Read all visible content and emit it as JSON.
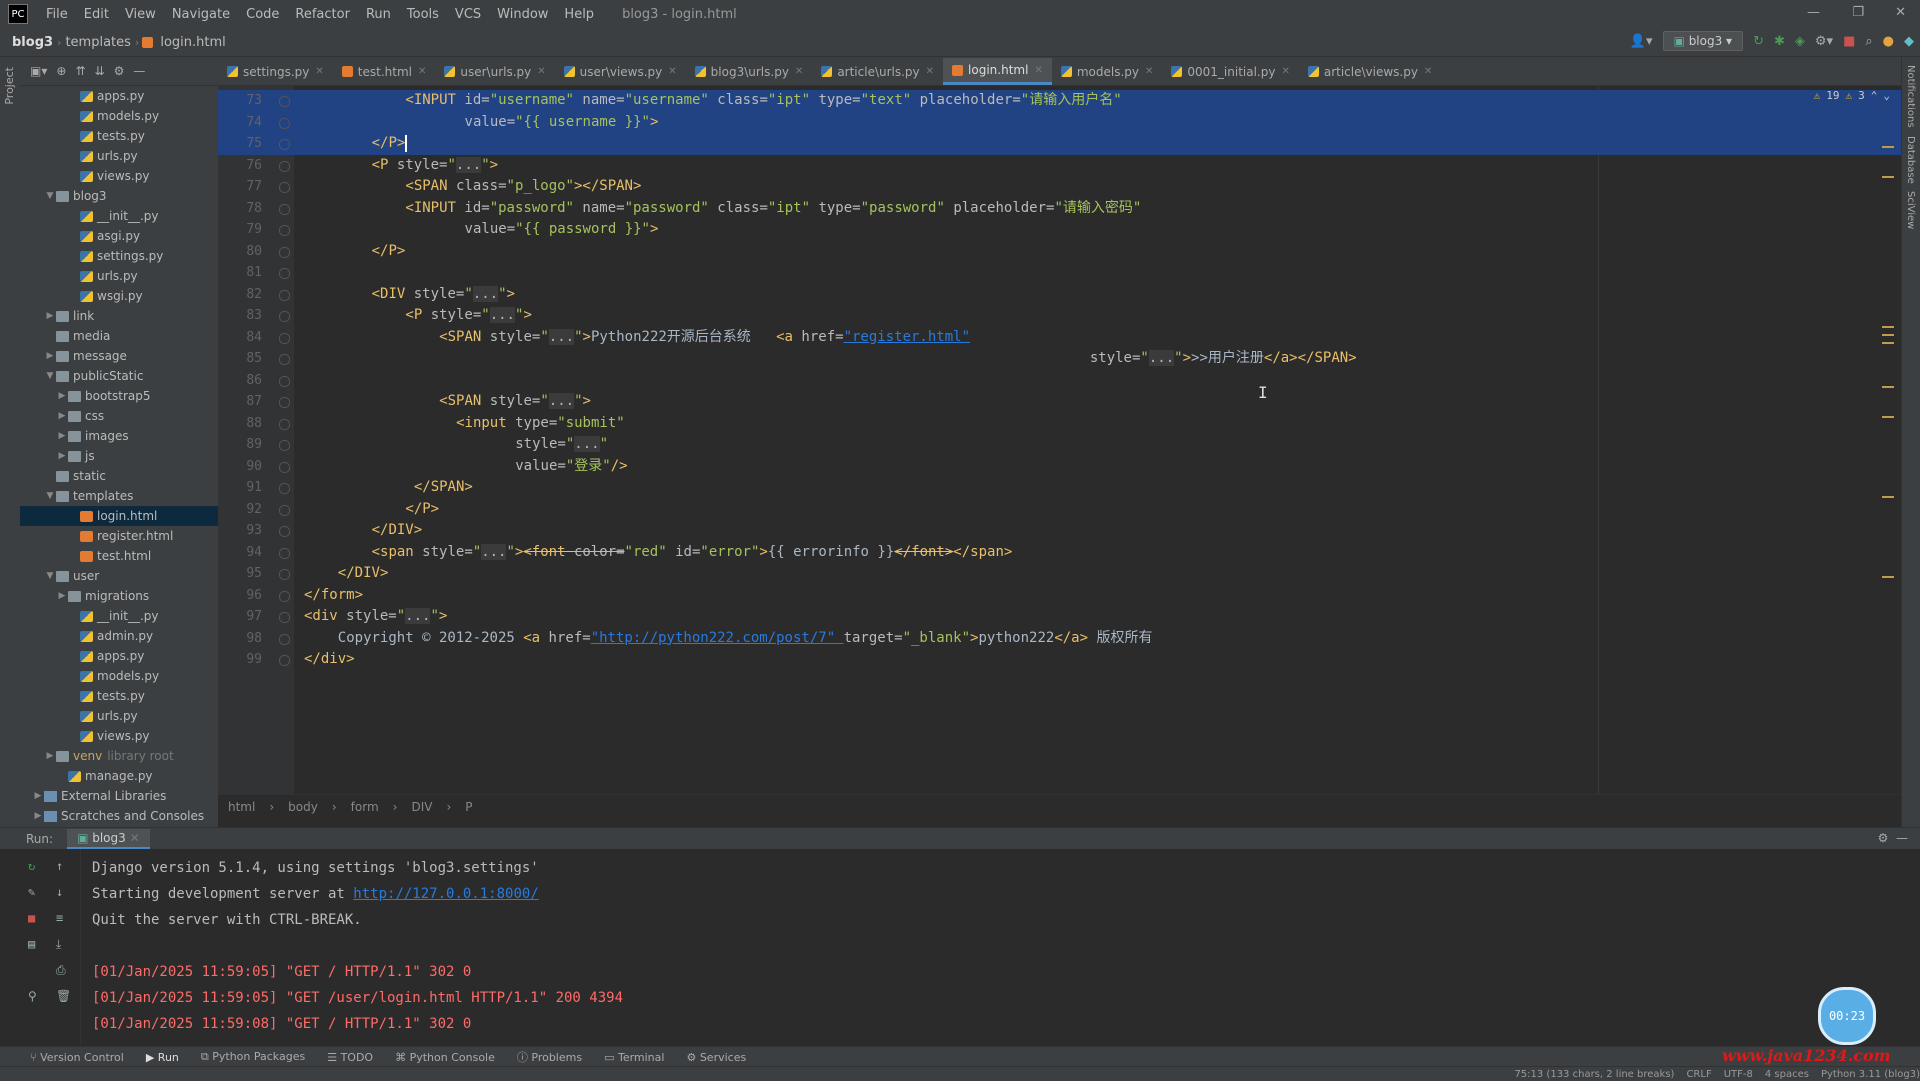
{
  "app": {
    "menu": [
      "File",
      "Edit",
      "View",
      "Navigate",
      "Code",
      "Refactor",
      "Run",
      "Tools",
      "VCS",
      "Window",
      "Help"
    ],
    "window_title": "blog3 - login.html",
    "breadcrumb": [
      "blog3",
      "templates",
      "login.html"
    ],
    "run_config": "blog3"
  },
  "project_tree": [
    {
      "label": "apps.py",
      "indent": 4,
      "type": "py"
    },
    {
      "label": "models.py",
      "indent": 4,
      "type": "py"
    },
    {
      "label": "tests.py",
      "indent": 4,
      "type": "py"
    },
    {
      "label": "urls.py",
      "indent": 4,
      "type": "py"
    },
    {
      "label": "views.py",
      "indent": 4,
      "type": "py"
    },
    {
      "label": "blog3",
      "indent": 2,
      "type": "folder",
      "open": true
    },
    {
      "label": "__init__.py",
      "indent": 4,
      "type": "py"
    },
    {
      "label": "asgi.py",
      "indent": 4,
      "type": "py"
    },
    {
      "label": "settings.py",
      "indent": 4,
      "type": "py"
    },
    {
      "label": "urls.py",
      "indent": 4,
      "type": "py"
    },
    {
      "label": "wsgi.py",
      "indent": 4,
      "type": "py"
    },
    {
      "label": "link",
      "indent": 2,
      "type": "folder",
      "open": false
    },
    {
      "label": "media",
      "indent": 2,
      "type": "folder",
      "leaf": true
    },
    {
      "label": "message",
      "indent": 2,
      "type": "folder",
      "open": false
    },
    {
      "label": "publicStatic",
      "indent": 2,
      "type": "folder",
      "open": true
    },
    {
      "label": "bootstrap5",
      "indent": 3,
      "type": "folder",
      "open": false
    },
    {
      "label": "css",
      "indent": 3,
      "type": "folder",
      "open": false
    },
    {
      "label": "images",
      "indent": 3,
      "type": "folder",
      "open": false
    },
    {
      "label": "js",
      "indent": 3,
      "type": "folder",
      "open": false
    },
    {
      "label": "static",
      "indent": 2,
      "type": "folder",
      "leaf": true
    },
    {
      "label": "templates",
      "indent": 2,
      "type": "folder",
      "open": true
    },
    {
      "label": "login.html",
      "indent": 4,
      "type": "html",
      "selected": true
    },
    {
      "label": "register.html",
      "indent": 4,
      "type": "html"
    },
    {
      "label": "test.html",
      "indent": 4,
      "type": "html"
    },
    {
      "label": "user",
      "indent": 2,
      "type": "folder",
      "open": true
    },
    {
      "label": "migrations",
      "indent": 3,
      "type": "folder",
      "open": false
    },
    {
      "label": "__init__.py",
      "indent": 4,
      "type": "py"
    },
    {
      "label": "admin.py",
      "indent": 4,
      "type": "py"
    },
    {
      "label": "apps.py",
      "indent": 4,
      "type": "py"
    },
    {
      "label": "models.py",
      "indent": 4,
      "type": "py"
    },
    {
      "label": "tests.py",
      "indent": 4,
      "type": "py"
    },
    {
      "label": "urls.py",
      "indent": 4,
      "type": "py"
    },
    {
      "label": "views.py",
      "indent": 4,
      "type": "py"
    },
    {
      "label": "venv",
      "indent": 2,
      "type": "folder",
      "open": false,
      "note": "library root"
    },
    {
      "label": "manage.py",
      "indent": 3,
      "type": "py"
    },
    {
      "label": "External Libraries",
      "indent": 1,
      "type": "lib",
      "open": false
    },
    {
      "label": "Scratches and Consoles",
      "indent": 1,
      "type": "lib",
      "open": false
    }
  ],
  "tabs": [
    {
      "label": "settings.py",
      "type": "py"
    },
    {
      "label": "test.html",
      "type": "html"
    },
    {
      "label": "user\\urls.py",
      "type": "py"
    },
    {
      "label": "user\\views.py",
      "type": "py"
    },
    {
      "label": "blog3\\urls.py",
      "type": "py"
    },
    {
      "label": "article\\urls.py",
      "type": "py"
    },
    {
      "label": "login.html",
      "type": "html",
      "active": true
    },
    {
      "label": "models.py",
      "type": "py"
    },
    {
      "label": "0001_initial.py",
      "type": "py"
    },
    {
      "label": "article\\views.py",
      "type": "py"
    }
  ],
  "inspections": {
    "warnings": "19",
    "weak": "3"
  },
  "code_lines": [
    {
      "n": "73",
      "indent": 12,
      "sel": true,
      "tokens": [
        [
          "tag",
          "<INPUT "
        ],
        [
          "attr",
          "id="
        ],
        [
          "str",
          "\"username\" "
        ],
        [
          "attr",
          "name="
        ],
        [
          "str",
          "\"username\" "
        ],
        [
          "attr",
          "class="
        ],
        [
          "str",
          "\"ipt\" "
        ],
        [
          "attr",
          "type="
        ],
        [
          "str",
          "\"text\" "
        ],
        [
          "attr",
          "placeholder="
        ],
        [
          "str",
          "\"请输入用户名\""
        ]
      ]
    },
    {
      "n": "74",
      "indent": 19,
      "sel": true,
      "tokens": [
        [
          "attr",
          "value="
        ],
        [
          "str",
          "\"{{ username }}\""
        ],
        [
          "tag",
          ">"
        ]
      ]
    },
    {
      "n": "75",
      "indent": 8,
      "sel": true,
      "caret": true,
      "tokens": [
        [
          "tag",
          "</P>"
        ]
      ]
    },
    {
      "n": "76",
      "indent": 8,
      "tokens": [
        [
          "tag",
          "<P "
        ],
        [
          "attr",
          "style="
        ],
        [
          "str",
          "\""
        ],
        [
          "fold",
          "..."
        ],
        [
          "str",
          "\""
        ],
        [
          "tag",
          ">"
        ]
      ]
    },
    {
      "n": "77",
      "indent": 12,
      "tokens": [
        [
          "tag",
          "<SPAN "
        ],
        [
          "attr",
          "class="
        ],
        [
          "str",
          "\"p_logo\""
        ],
        [
          "tag",
          "></SPAN>"
        ]
      ]
    },
    {
      "n": "78",
      "indent": 12,
      "tokens": [
        [
          "tag",
          "<INPUT "
        ],
        [
          "attr",
          "id="
        ],
        [
          "str",
          "\"password\" "
        ],
        [
          "attr",
          "name="
        ],
        [
          "str",
          "\"password\" "
        ],
        [
          "attr",
          "class="
        ],
        [
          "str",
          "\"ipt\" "
        ],
        [
          "attr",
          "type="
        ],
        [
          "str",
          "\"password\" "
        ],
        [
          "attr",
          "placeholder="
        ],
        [
          "str",
          "\"请输入密码\""
        ]
      ]
    },
    {
      "n": "79",
      "indent": 19,
      "tokens": [
        [
          "attr",
          "value="
        ],
        [
          "str",
          "\"{{ password }}\""
        ],
        [
          "tag",
          ">"
        ]
      ]
    },
    {
      "n": "80",
      "indent": 8,
      "tokens": [
        [
          "tag",
          "</P>"
        ]
      ]
    },
    {
      "n": "81",
      "indent": 0,
      "tokens": []
    },
    {
      "n": "82",
      "indent": 8,
      "tokens": [
        [
          "tag",
          "<DIV "
        ],
        [
          "attr",
          "style="
        ],
        [
          "str",
          "\""
        ],
        [
          "fold",
          "..."
        ],
        [
          "str",
          "\""
        ],
        [
          "tag",
          ">"
        ]
      ]
    },
    {
      "n": "83",
      "indent": 12,
      "tokens": [
        [
          "tag",
          "<P "
        ],
        [
          "attr",
          "style="
        ],
        [
          "str",
          "\""
        ],
        [
          "fold",
          "..."
        ],
        [
          "str",
          "\""
        ],
        [
          "tag",
          ">"
        ]
      ]
    },
    {
      "n": "84",
      "indent": 16,
      "tokens": [
        [
          "tag",
          "<SPAN "
        ],
        [
          "attr",
          "style="
        ],
        [
          "str",
          "\""
        ],
        [
          "fold",
          "..."
        ],
        [
          "str",
          "\""
        ],
        [
          "tag",
          ">"
        ],
        [
          "text",
          "Python222开源后台系统   "
        ],
        [
          "tag",
          "<a "
        ],
        [
          "attr",
          "href="
        ],
        [
          "link",
          "\"register.html\""
        ]
      ]
    },
    {
      "n": "85",
      "indent": 93,
      "tokens": [
        [
          "attr",
          "style="
        ],
        [
          "str",
          "\""
        ],
        [
          "fold",
          "..."
        ],
        [
          "str",
          "\""
        ],
        [
          "tag",
          ">"
        ],
        [
          "text",
          ">>用户注册"
        ],
        [
          "tag",
          "</a></SPAN>"
        ]
      ]
    },
    {
      "n": "86",
      "indent": 0,
      "tokens": []
    },
    {
      "n": "87",
      "indent": 16,
      "tokens": [
        [
          "tag",
          "<SPAN "
        ],
        [
          "attr",
          "style="
        ],
        [
          "str",
          "\""
        ],
        [
          "fold",
          "..."
        ],
        [
          "str",
          "\""
        ],
        [
          "tag",
          ">"
        ]
      ]
    },
    {
      "n": "88",
      "indent": 18,
      "tokens": [
        [
          "tag",
          "<input "
        ],
        [
          "attr",
          "type="
        ],
        [
          "str",
          "\"submit\""
        ]
      ]
    },
    {
      "n": "89",
      "indent": 25,
      "tokens": [
        [
          "attr",
          "style="
        ],
        [
          "str",
          "\""
        ],
        [
          "fold",
          "..."
        ],
        [
          "str",
          "\""
        ]
      ]
    },
    {
      "n": "90",
      "indent": 25,
      "tokens": [
        [
          "attr",
          "value="
        ],
        [
          "str",
          "\"登录\""
        ],
        [
          "tag",
          "/>"
        ]
      ]
    },
    {
      "n": "91",
      "indent": 13,
      "tokens": [
        [
          "tag",
          "</SPAN>"
        ]
      ]
    },
    {
      "n": "92",
      "indent": 12,
      "tokens": [
        [
          "tag",
          "</P>"
        ]
      ]
    },
    {
      "n": "93",
      "indent": 8,
      "tokens": [
        [
          "tag",
          "</DIV>"
        ]
      ]
    },
    {
      "n": "94",
      "indent": 8,
      "tokens": [
        [
          "tag",
          "<span "
        ],
        [
          "attr",
          "style="
        ],
        [
          "str",
          "\""
        ],
        [
          "fold",
          "..."
        ],
        [
          "str",
          "\""
        ],
        [
          "tag",
          ">"
        ],
        [
          "strike",
          "<font "
        ],
        [
          "strikeattr",
          "color="
        ],
        [
          "str",
          "\"red\" "
        ],
        [
          "attr",
          "id="
        ],
        [
          "str",
          "\"error\""
        ],
        [
          "tag",
          ">"
        ],
        [
          "text",
          "{{ errorinfo }}"
        ],
        [
          "strike",
          "</font>"
        ],
        [
          "tag",
          "</span>"
        ]
      ]
    },
    {
      "n": "95",
      "indent": 4,
      "tokens": [
        [
          "tag",
          "</DIV>"
        ]
      ]
    },
    {
      "n": "96",
      "indent": 0,
      "tokens": [
        [
          "tag",
          "</form>"
        ]
      ]
    },
    {
      "n": "97",
      "indent": 0,
      "tokens": [
        [
          "tag",
          "<div "
        ],
        [
          "attr",
          "style="
        ],
        [
          "str",
          "\""
        ],
        [
          "fold",
          "..."
        ],
        [
          "str",
          "\""
        ],
        [
          "tag",
          ">"
        ]
      ]
    },
    {
      "n": "98",
      "indent": 4,
      "tokens": [
        [
          "text",
          "Copyright © 2012-2025 "
        ],
        [
          "tag",
          "<a "
        ],
        [
          "attr",
          "href="
        ],
        [
          "link",
          "\"http://python222.com/post/7\" "
        ],
        [
          "attr",
          "target="
        ],
        [
          "str",
          "\"_blank\""
        ],
        [
          "tag",
          ">"
        ],
        [
          "text",
          "python222"
        ],
        [
          "tag",
          "</a>"
        ],
        [
          "text",
          " 版权所有"
        ]
      ]
    },
    {
      "n": "99",
      "indent": 0,
      "tokens": [
        [
          "tag",
          "</div>"
        ]
      ]
    }
  ],
  "editor_breadcrumb": [
    "html",
    "body",
    "form",
    "DIV",
    "P"
  ],
  "run": {
    "label": "Run:",
    "tab": "blog3",
    "console": [
      {
        "type": "norm",
        "text": "Django version 5.1.4, using settings 'blog3.settings'"
      },
      {
        "type": "mixed",
        "prefix": "Starting development server at ",
        "link": "http://127.0.0.1:8000/"
      },
      {
        "type": "norm",
        "text": "Quit the server with CTRL-BREAK."
      },
      {
        "type": "blank",
        "text": ""
      },
      {
        "type": "err",
        "text": "[01/Jan/2025 11:59:05] \"GET / HTTP/1.1\" 302 0"
      },
      {
        "type": "err",
        "text": "[01/Jan/2025 11:59:05] \"GET /user/login.html HTTP/1.1\" 200 4394"
      },
      {
        "type": "err",
        "text": "[01/Jan/2025 11:59:08] \"GET / HTTP/1.1\" 302 0"
      }
    ],
    "timer": "00:23"
  },
  "tool_buttons": [
    "Version Control",
    "Run",
    "Python Packages",
    "TODO",
    "Python Console",
    "Problems",
    "Terminal",
    "Services"
  ],
  "status": {
    "position": "75:13 (133 chars, 2 line breaks)",
    "line_sep": "CRLF",
    "encoding": "UTF-8",
    "indent": "4 spaces",
    "interpreter": "Python 3.11 (blog3)"
  },
  "watermark": "www.java1234.com",
  "side_labels": {
    "left": "Project",
    "right_a": "Notifications",
    "right_b": "Database",
    "right_c": "SciView"
  }
}
